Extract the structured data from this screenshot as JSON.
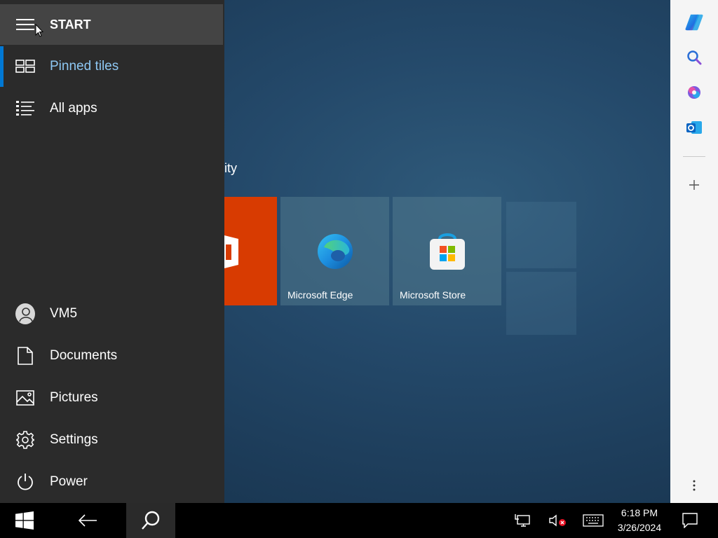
{
  "start_menu": {
    "header_label": "START",
    "items": [
      {
        "id": "pinned",
        "label": "Pinned tiles",
        "icon": "pinned-tiles-icon",
        "selected": true
      },
      {
        "id": "allapps",
        "label": "All apps",
        "icon": "all-apps-list-icon"
      }
    ],
    "bottom_items": [
      {
        "id": "user",
        "label": "VM5",
        "icon": "user-avatar"
      },
      {
        "id": "documents",
        "label": "Documents",
        "icon": "document-icon"
      },
      {
        "id": "pictures",
        "label": "Pictures",
        "icon": "pictures-icon"
      },
      {
        "id": "settings",
        "label": "Settings",
        "icon": "gear-icon"
      },
      {
        "id": "power",
        "label": "Power",
        "icon": "power-icon"
      }
    ],
    "accent_color": "#0078d4",
    "selected_text_color": "#8ec8f4"
  },
  "tiles": {
    "group_title_partial": "ity",
    "items": [
      {
        "label": "",
        "icon": "office-icon",
        "color": "#d83b01"
      },
      {
        "label": "Microsoft Edge",
        "icon": "edge-icon"
      },
      {
        "label": "Microsoft Store",
        "icon": "store-icon"
      }
    ]
  },
  "sidebar": {
    "buttons": [
      "copilot-icon",
      "search-icon",
      "office-m365-icon",
      "outlook-icon",
      "add-icon",
      "more-icon"
    ]
  },
  "taskbar": {
    "buttons": [
      "windows-start-icon",
      "back-arrow-icon",
      "search-icon"
    ],
    "tray": [
      "network-icon",
      "volume-muted-icon",
      "keyboard-icon",
      "notifications-icon"
    ],
    "time": "6:18 PM",
    "date": "3/26/2024"
  }
}
